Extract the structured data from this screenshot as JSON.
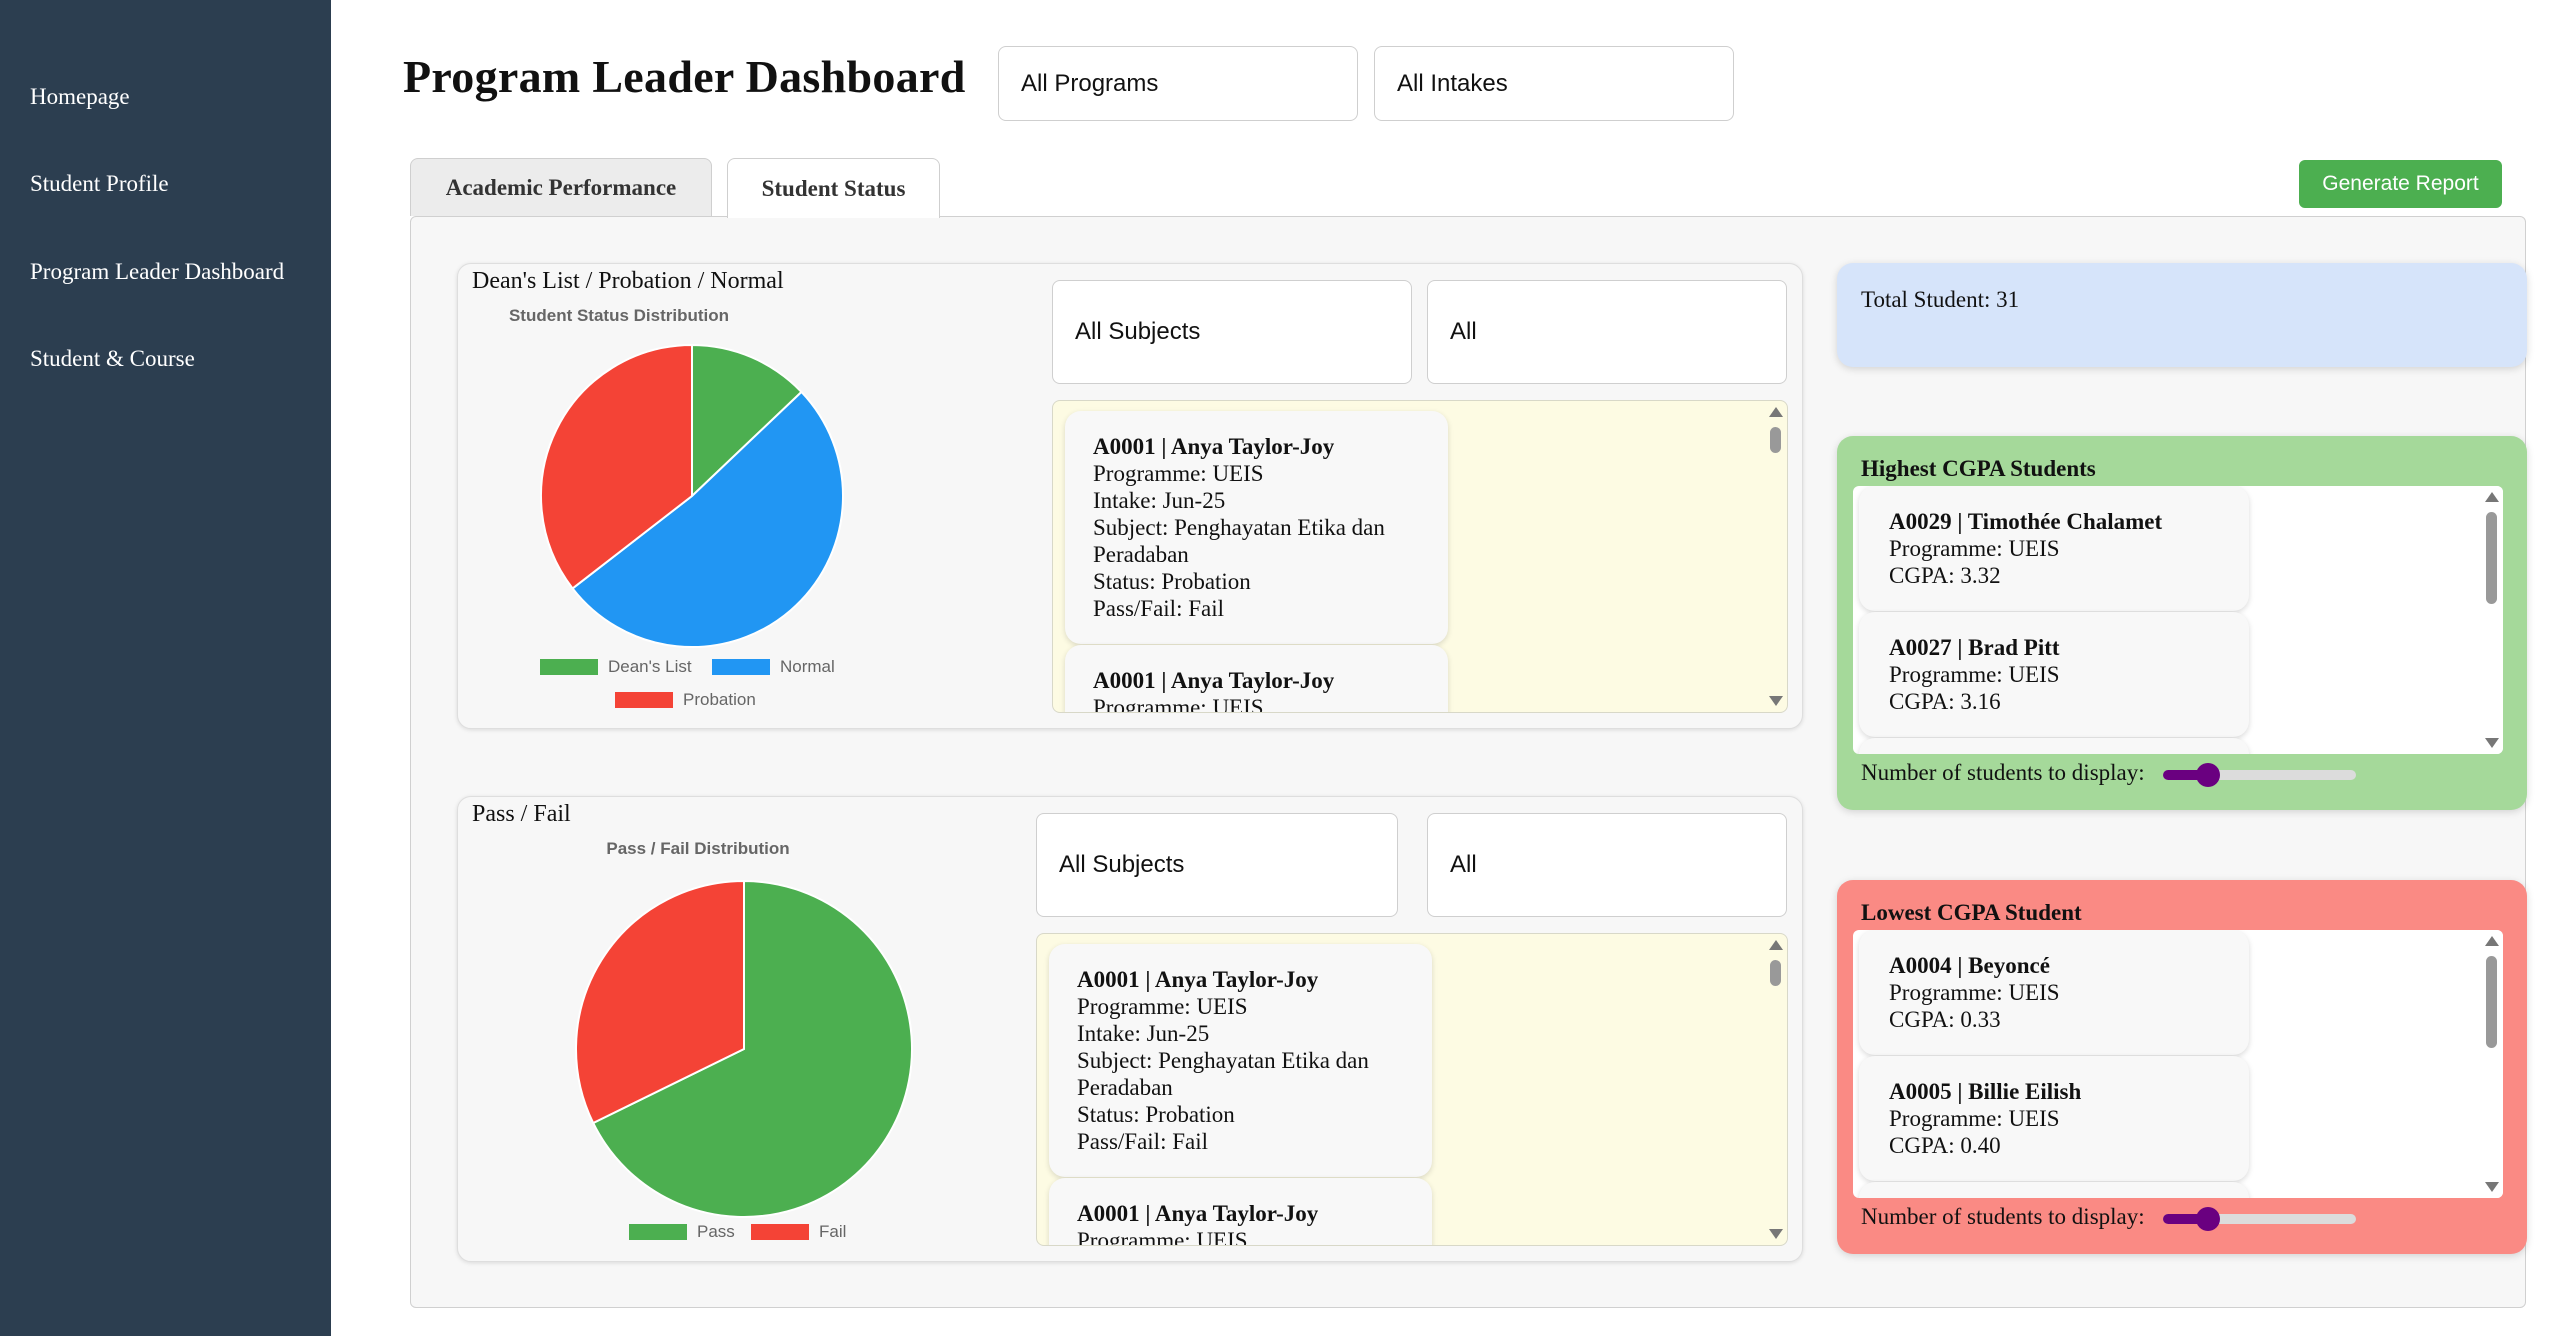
{
  "sidebar": {
    "items": [
      {
        "label": "Homepage"
      },
      {
        "label": "Student Profile"
      },
      {
        "label": "Program Leader Dashboard"
      },
      {
        "label": "Student & Course"
      }
    ]
  },
  "header": {
    "title": "Program Leader Dashboard",
    "program_filter": "All Programs",
    "intake_filter": "All Intakes"
  },
  "tabs": [
    {
      "label": "Academic Performance",
      "active": false
    },
    {
      "label": "Student Status",
      "active": true
    }
  ],
  "generate_report_label": "Generate Report",
  "status_section": {
    "title": "Dean's List / Probation / Normal",
    "subject_filter": "All Subjects",
    "status_filter": "All",
    "records": [
      {
        "header": "A0001 | Anya Taylor-Joy",
        "programme": "Programme: UEIS",
        "intake": "Intake: Jun-25",
        "subject": "Subject: Penghayatan Etika dan Peradaban",
        "status": "Status: Probation",
        "passfail": "Pass/Fail: Fail"
      },
      {
        "header": "A0001 | Anya Taylor-Joy",
        "programme": "Programme: UEIS"
      }
    ]
  },
  "passfail_section": {
    "title": "Pass / Fail",
    "subject_filter": "All Subjects",
    "status_filter": "All",
    "records": [
      {
        "header": "A0001 | Anya Taylor-Joy",
        "programme": "Programme: UEIS",
        "intake": "Intake: Jun-25",
        "subject": "Subject: Penghayatan Etika dan Peradaban",
        "status": "Status: Probation",
        "passfail": "Pass/Fail: Fail"
      },
      {
        "header": "A0001 | Anya Taylor-Joy",
        "programme": "Programme: UEIS"
      }
    ]
  },
  "chart_data": [
    {
      "type": "pie",
      "title": "Student Status Distribution",
      "categories": [
        "Dean's List",
        "Normal",
        "Probation"
      ],
      "values": [
        4,
        16,
        11
      ],
      "colors": [
        "#4caf50",
        "#2196f3",
        "#f44336"
      ],
      "legend": "bottom"
    },
    {
      "type": "pie",
      "title": "Pass / Fail Distribution",
      "categories": [
        "Pass",
        "Fail"
      ],
      "values": [
        21,
        10
      ],
      "colors": [
        "#4caf50",
        "#f44336"
      ],
      "legend": "bottom"
    }
  ],
  "total_student": {
    "label": "Total Student: 31",
    "color": "#d6e4fa"
  },
  "highest_cgpa": {
    "title": "Highest CGPA Students",
    "color": "#a5d99a",
    "students": [
      {
        "header": "A0029 | Timothée Chalamet",
        "programme": "Programme: UEIS",
        "cgpa": "CGPA: 3.32"
      },
      {
        "header": "A0027 | Brad Pitt",
        "programme": "Programme: UEIS",
        "cgpa": "CGPA: 3.16"
      }
    ],
    "slider_label": "Number of students to display:",
    "slider_value": 0.2
  },
  "lowest_cgpa": {
    "title": "Lowest CGPA Student",
    "color": "#fa8a84",
    "students": [
      {
        "header": "A0004 | Beyoncé",
        "programme": "Programme: UEIS",
        "cgpa": "CGPA: 0.33"
      },
      {
        "header": "A0005 | Billie Eilish",
        "programme": "Programme: UEIS",
        "cgpa": "CGPA: 0.40"
      }
    ],
    "slider_label": "Number of students to display:",
    "slider_value": 0.2
  }
}
